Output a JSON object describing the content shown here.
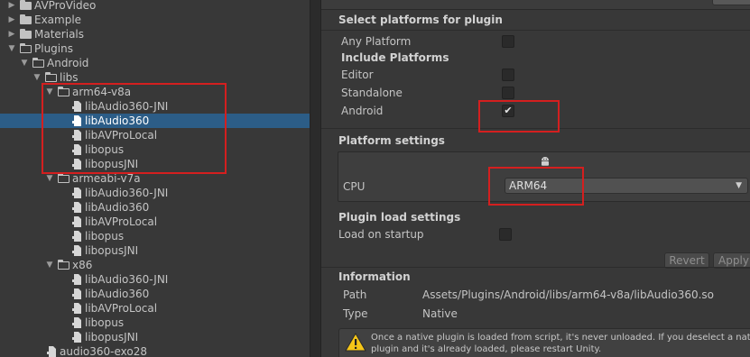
{
  "project_tree": {
    "rows": [
      {
        "label": "AVProVideo",
        "depth": 0,
        "kind": "folder",
        "expanded": false,
        "selected": false
      },
      {
        "label": "Example",
        "depth": 0,
        "kind": "folder",
        "expanded": false,
        "selected": false
      },
      {
        "label": "Materials",
        "depth": 0,
        "kind": "folder",
        "expanded": false,
        "selected": false
      },
      {
        "label": "Plugins",
        "depth": 0,
        "kind": "folder",
        "expanded": true,
        "selected": false
      },
      {
        "label": "Android",
        "depth": 1,
        "kind": "folder",
        "expanded": true,
        "selected": false
      },
      {
        "label": "libs",
        "depth": 2,
        "kind": "folder",
        "expanded": true,
        "selected": false
      },
      {
        "label": "arm64-v8a",
        "depth": 3,
        "kind": "folder",
        "expanded": true,
        "selected": false
      },
      {
        "label": "libAudio360-JNI",
        "depth": 4,
        "kind": "plugin",
        "selected": false
      },
      {
        "label": "libAudio360",
        "depth": 4,
        "kind": "plugin",
        "selected": true
      },
      {
        "label": "libAVProLocal",
        "depth": 4,
        "kind": "plugin",
        "selected": false
      },
      {
        "label": "libopus",
        "depth": 4,
        "kind": "plugin",
        "selected": false
      },
      {
        "label": "libopusJNI",
        "depth": 4,
        "kind": "plugin",
        "selected": false
      },
      {
        "label": "armeabi-v7a",
        "depth": 3,
        "kind": "folder",
        "expanded": true,
        "selected": false
      },
      {
        "label": "libAudio360-JNI",
        "depth": 4,
        "kind": "plugin",
        "selected": false
      },
      {
        "label": "libAudio360",
        "depth": 4,
        "kind": "plugin",
        "selected": false
      },
      {
        "label": "libAVProLocal",
        "depth": 4,
        "kind": "plugin",
        "selected": false
      },
      {
        "label": "libopus",
        "depth": 4,
        "kind": "plugin",
        "selected": false
      },
      {
        "label": "libopusJNI",
        "depth": 4,
        "kind": "plugin",
        "selected": false
      },
      {
        "label": "x86",
        "depth": 3,
        "kind": "folder",
        "expanded": true,
        "selected": false
      },
      {
        "label": "libAudio360-JNI",
        "depth": 4,
        "kind": "plugin",
        "selected": false
      },
      {
        "label": "libAudio360",
        "depth": 4,
        "kind": "plugin",
        "selected": false
      },
      {
        "label": "libAVProLocal",
        "depth": 4,
        "kind": "plugin",
        "selected": false
      },
      {
        "label": "libopus",
        "depth": 4,
        "kind": "plugin",
        "selected": false
      },
      {
        "label": "libopusJNI",
        "depth": 4,
        "kind": "plugin",
        "selected": false
      },
      {
        "label": "audio360-exo28",
        "depth": 2,
        "kind": "plugin",
        "selected": false
      }
    ]
  },
  "inspector": {
    "select_platforms_title": "Select platforms for plugin",
    "any_platform": {
      "label": "Any Platform",
      "checked": false
    },
    "include_platforms_title": "Include Platforms",
    "platforms": [
      {
        "label": "Editor",
        "checked": false
      },
      {
        "label": "Standalone",
        "checked": false
      },
      {
        "label": "Android",
        "checked": true,
        "mark": "✔"
      }
    ],
    "platform_settings_title": "Platform settings",
    "android_icon": "android-icon",
    "cpu_label": "CPU",
    "cpu_value": "ARM64",
    "dropdown_caret": "▼",
    "plugin_load_title": "Plugin load settings",
    "load_on_startup": {
      "label": "Load on startup",
      "checked": false
    },
    "revert_label": "Revert",
    "apply_label": "Apply",
    "information_title": "Information",
    "path_label": "Path",
    "path_value": "Assets/Plugins/Android/libs/arm64-v8a/libAudio360.so",
    "type_label": "Type",
    "type_value": "Native",
    "help_line1": "Once a native plugin is loaded from script, it's never unloaded. If you deselect a native",
    "help_line2": "plugin and it's already loaded, please restart Unity.",
    "warning_icon": "warning-icon"
  },
  "colors": {
    "selection": "#2c5d87",
    "highlight_annotation": "#d41f1f",
    "panel_bg": "#383838"
  }
}
